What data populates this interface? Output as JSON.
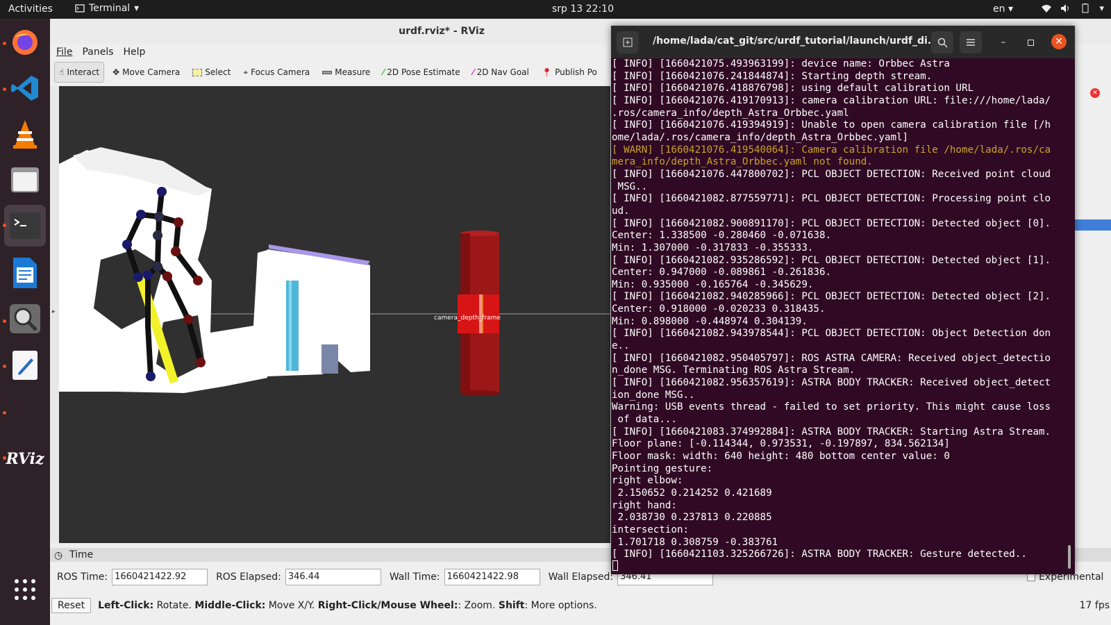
{
  "topbar": {
    "activities": "Activities",
    "app_name": "Terminal",
    "clock": "srp 13  22:10",
    "lang": "en"
  },
  "dock": {
    "items": [
      "firefox-icon",
      "vscode-icon",
      "vlc-icon",
      "files-icon",
      "terminal-icon",
      "writer-icon",
      "image-viewer-icon",
      "text-editor-icon",
      "rviz-icon",
      "app-grid-icon"
    ]
  },
  "rviz": {
    "title": "urdf.rviz* - RViz",
    "menu": [
      "File",
      "Panels",
      "Help"
    ],
    "tools": [
      "Interact",
      "Move Camera",
      "Select",
      "Focus Camera",
      "Measure",
      "2D Pose Estimate",
      "2D Nav Goal",
      "Publish Po"
    ],
    "time_panel": {
      "title": "Time",
      "ros_time_label": "ROS Time:",
      "ros_time": "1660421422.92",
      "ros_elapsed_label": "ROS Elapsed:",
      "ros_elapsed": "346.44",
      "wall_time_label": "Wall Time:",
      "wall_time": "1660421422.98",
      "wall_elapsed_label": "Wall Elapsed:",
      "wall_elapsed": "346.41",
      "experimental": "Experimental"
    },
    "status": {
      "reset": "Reset",
      "left_click": "Left-Click:",
      "left_click_desc": " Rotate. ",
      "middle_click": "Middle-Click:",
      "middle_click_desc": " Move X/Y. ",
      "right_click": "Right-Click/Mouse Wheel:",
      "right_click_desc": ": Zoom. ",
      "shift": "Shift",
      "shift_desc": ": More options.",
      "fps": "17 fps"
    },
    "viewport_label": "camera_depth_frame"
  },
  "terminal": {
    "title": "/home/lada/cat_git/src/urdf_tutorial/launch/urdf_di...",
    "lines": [
      {
        "text": "[ INFO] [1660421075.493963199]: device name: Orbbec Astra",
        "warn": false
      },
      {
        "text": "[ INFO] [1660421076.241844874]: Starting depth stream.",
        "warn": false
      },
      {
        "text": "[ INFO] [1660421076.418876798]: using default calibration URL",
        "warn": false
      },
      {
        "text": "[ INFO] [1660421076.419170913]: camera calibration URL: file:///home/lada/",
        "warn": false
      },
      {
        "text": ".ros/camera_info/depth_Astra_Orbbec.yaml",
        "warn": false
      },
      {
        "text": "[ INFO] [1660421076.419394919]: Unable to open camera calibration file [/h",
        "warn": false
      },
      {
        "text": "ome/lada/.ros/camera_info/depth_Astra_Orbbec.yaml]",
        "warn": false
      },
      {
        "text": "[ WARN] [1660421076.419540064]: Camera calibration file /home/lada/.ros/ca",
        "warn": true
      },
      {
        "text": "mera_info/depth_Astra_Orbbec.yaml not found.",
        "warn": true
      },
      {
        "text": "[ INFO] [1660421076.447800702]: PCL OBJECT DETECTION: Received point cloud",
        "warn": false
      },
      {
        "text": " MSG..",
        "warn": false
      },
      {
        "text": "[ INFO] [1660421082.877559771]: PCL OBJECT DETECTION: Processing point clo",
        "warn": false
      },
      {
        "text": "ud.",
        "warn": false
      },
      {
        "text": "[ INFO] [1660421082.900891170]: PCL OBJECT DETECTION: Detected object [0].",
        "warn": false
      },
      {
        "text": "Center: 1.338500 -0.280460 -0.071638.",
        "warn": false
      },
      {
        "text": "Min: 1.307000 -0.317833 -0.355333.",
        "warn": false
      },
      {
        "text": "[ INFO] [1660421082.935286592]: PCL OBJECT DETECTION: Detected object [1].",
        "warn": false
      },
      {
        "text": "Center: 0.947000 -0.089861 -0.261836.",
        "warn": false
      },
      {
        "text": "Min: 0.935000 -0.165764 -0.345629.",
        "warn": false
      },
      {
        "text": "[ INFO] [1660421082.940285966]: PCL OBJECT DETECTION: Detected object [2].",
        "warn": false
      },
      {
        "text": "Center: 0.918000 -0.020233 0.318435.",
        "warn": false
      },
      {
        "text": "Min: 0.898000 -0.448974 0.304139.",
        "warn": false
      },
      {
        "text": "[ INFO] [1660421082.943978544]: PCL OBJECT DETECTION: Object Detection don",
        "warn": false
      },
      {
        "text": "e..",
        "warn": false
      },
      {
        "text": "[ INFO] [1660421082.950405797]: ROS ASTRA CAMERA: Received object_detectio",
        "warn": false
      },
      {
        "text": "n_done MSG. Terminating ROS Astra Stream.",
        "warn": false
      },
      {
        "text": "[ INFO] [1660421082.956357619]: ASTRA BODY TRACKER: Received object_detect",
        "warn": false
      },
      {
        "text": "ion_done MSG..",
        "warn": false
      },
      {
        "text": "Warning: USB events thread - failed to set priority. This might cause loss",
        "warn": false
      },
      {
        "text": " of data...",
        "warn": false
      },
      {
        "text": "[ INFO] [1660421083.374992884]: ASTRA BODY TRACKER: Starting Astra Stream.",
        "warn": false
      },
      {
        "text": "Floor plane: [-0.114344, 0.973531, -0.197897, 834.562134]",
        "warn": false
      },
      {
        "text": "Floor mask: width: 640 height: 480 bottom center value: 0",
        "warn": false
      },
      {
        "text": "Pointing gesture:",
        "warn": false
      },
      {
        "text": "right elbow:",
        "warn": false
      },
      {
        "text": " 2.150652 0.214252 0.421689",
        "warn": false
      },
      {
        "text": "right hand:",
        "warn": false
      },
      {
        "text": " 2.038730 0.237813 0.220885",
        "warn": false
      },
      {
        "text": "intersection:",
        "warn": false
      },
      {
        "text": " 1.701718 0.308759 -0.383761",
        "warn": false
      },
      {
        "text": "[ INFO] [1660421103.325266726]: ASTRA BODY TRACKER: Gesture detected..",
        "warn": false
      }
    ]
  }
}
